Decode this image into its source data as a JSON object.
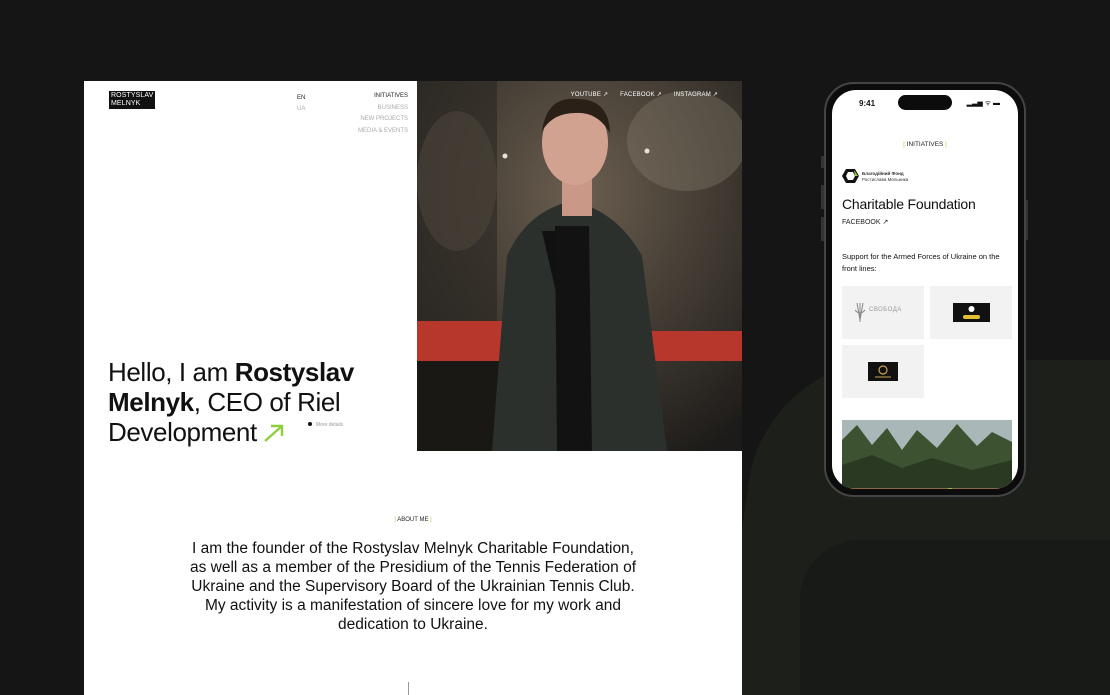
{
  "desktop": {
    "logo_line1": "ROSTYSLAV",
    "logo_line2": "MELNYK",
    "lang_active": "EN",
    "lang_other": "UA",
    "nav": {
      "active": "INITIATIVES",
      "items": [
        "BUSINESS",
        "NEW PROJECTS",
        "MEDIA & EVENTS"
      ]
    },
    "social": {
      "youtube": "YOUTUBE ↗",
      "facebook": "FACEBOOK ↗",
      "instagram": "INSTAGRAM ↗"
    },
    "hero": {
      "pre": "Hello, I am ",
      "name": "Rostyslav Melnyk",
      "post": ", CEO of Riel Development"
    },
    "more_details": "More details",
    "about_tag": "ABOUT ME",
    "about_text": "I am the founder of the Rostyslav Melnyk Charitable Foundation, as well as a member of the Presidium of the Tennis Federation of Ukraine and the Supervisory Board of the Ukrainian Tennis Club. My activity is a manifestation of sincere love for my work and dedication to Ukraine."
  },
  "phone": {
    "time": "9:41",
    "status_icons": "▂▃▅ ᯤ ▬",
    "tag": "INITIATIVES",
    "fund_logo_line1": "Благодійний Фонд",
    "fund_logo_line2": "Ростислава Мельника",
    "title": "Charitable Foundation",
    "facebook": "FACEBOOK ↗",
    "support": "Support for the Armed Forces of Ukraine on the front lines:",
    "tile1_label": "СВОБОДА"
  },
  "colors": {
    "accent": "#8fcf3c",
    "background": "#151515"
  }
}
